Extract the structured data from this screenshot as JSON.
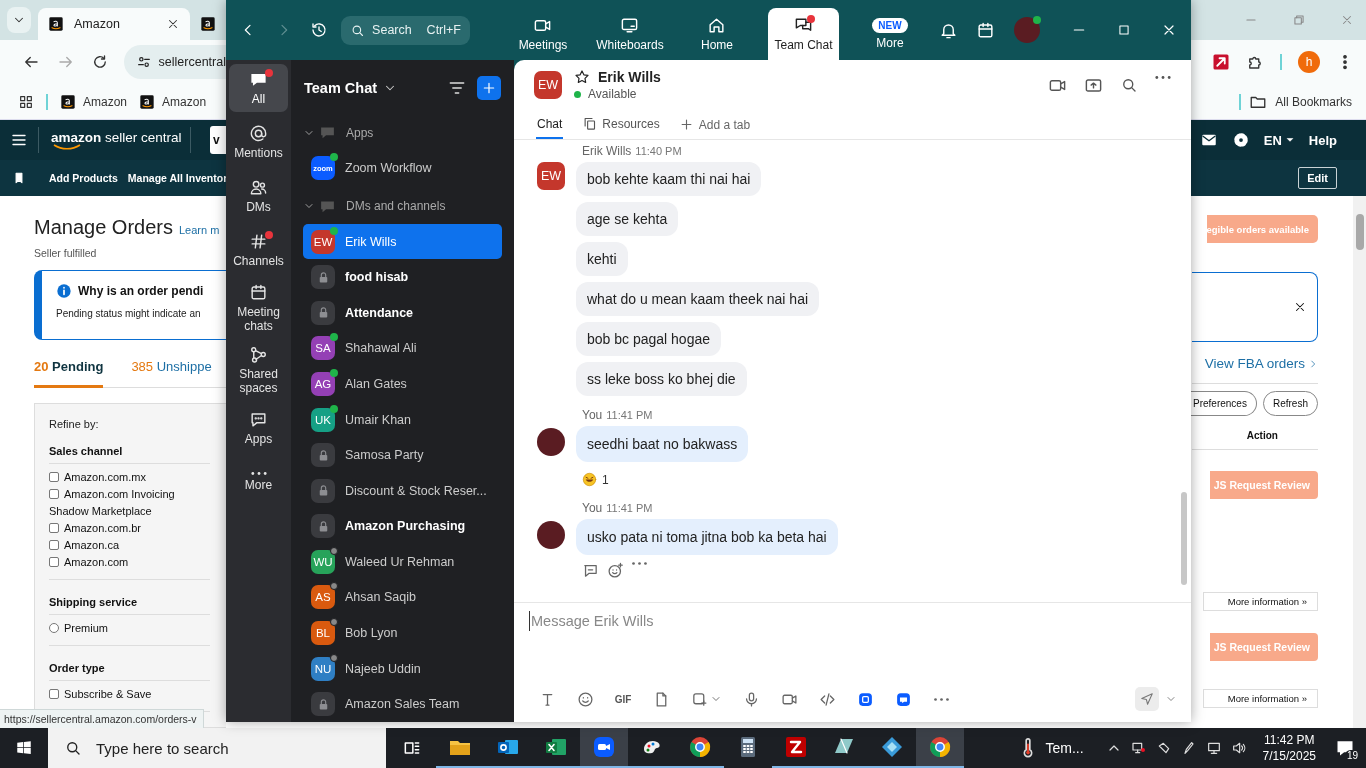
{
  "browser": {
    "tabs": [
      {
        "title": "Amazon",
        "selected": true
      },
      {
        "selected": false
      }
    ],
    "address": "sellercentral",
    "bookmarks": [
      "Amazon",
      "Amazon"
    ],
    "all_bookmarks": "All Bookmarks",
    "profile_initial": "h",
    "status_url": "https://sellercentral.amazon.com/orders-v"
  },
  "seller_central": {
    "logo_text": "**amazon** seller central",
    "search_box": "v",
    "nav_links": [
      "Add Products",
      "Manage All Inventor"
    ],
    "language": "EN",
    "help": "Help",
    "edit": "Edit",
    "title": "Manage Orders",
    "learn_more": "Learn m",
    "subtitle": "Seller fulfilled",
    "eligible_banner": "egible orders available",
    "notice": {
      "title": "Why is an order pendi",
      "text": "Pending status might indicate an"
    },
    "order_tabs": [
      {
        "count": "20",
        "label": "Pending",
        "selected": true
      },
      {
        "count": "385",
        "label": "Unshippe",
        "selected": false
      }
    ],
    "fba_link": "View FBA orders",
    "buttons": [
      "Preferences",
      "Refresh"
    ],
    "column_header": "Action",
    "rows": [
      {
        "action": "JS Request Review",
        "more": "More information »"
      },
      {
        "action": "JS Request Review",
        "more": "More information »"
      }
    ],
    "filters": {
      "title": "Refine by:",
      "groups": [
        {
          "title": "Sales channel",
          "options": [
            {
              "kind": "checkbox",
              "label": "Amazon.com.mx",
              "checked": false
            },
            {
              "kind": "checkbox",
              "label": "Amazon.com Invoicing Shadow Marketplace",
              "checked": false
            },
            {
              "kind": "checkbox",
              "label": "Amazon.com.br",
              "checked": false
            },
            {
              "kind": "checkbox",
              "label": "Amazon.ca",
              "checked": false
            },
            {
              "kind": "checkbox",
              "label": "Amazon.com",
              "checked": false
            }
          ]
        },
        {
          "title": "Shipping service",
          "options": [
            {
              "kind": "radio",
              "label": "Premium",
              "checked": false
            }
          ]
        },
        {
          "title": "Order type",
          "options": [
            {
              "kind": "checkbox",
              "label": "Subscribe & Save",
              "checked": false
            }
          ]
        }
      ]
    }
  },
  "zoom": {
    "search": {
      "placeholder": "Search",
      "shortcut": "Ctrl+F"
    },
    "nav": [
      {
        "kind": "meetings",
        "label": "Meetings",
        "selected": false,
        "dot": false
      },
      {
        "kind": "whiteboards",
        "label": "Whiteboards",
        "selected": false,
        "dot": false
      },
      {
        "kind": "home",
        "label": "Home",
        "selected": false,
        "dot": false
      },
      {
        "kind": "chat",
        "label": "Team Chat",
        "selected": true,
        "dot": true
      },
      {
        "kind": "more",
        "label": "More",
        "selected": false,
        "dot": false,
        "badge": "NEW"
      }
    ],
    "rail": [
      {
        "kind": "all",
        "label": "All",
        "selected": true,
        "dot": true
      },
      {
        "kind": "mentions",
        "label": "Mentions",
        "selected": false,
        "dot": false
      },
      {
        "kind": "dms",
        "label": "DMs",
        "selected": false,
        "dot": false
      },
      {
        "kind": "channels",
        "label": "Channels",
        "selected": false,
        "dot": true
      },
      {
        "kind": "meetings",
        "label": "Meeting chats",
        "selected": false,
        "dot": false
      },
      {
        "kind": "spaces",
        "label": "Shared spaces",
        "selected": false,
        "dot": false
      },
      {
        "kind": "apps",
        "label": "Apps",
        "selected": false,
        "dot": false
      },
      {
        "kind": "more",
        "label": "More",
        "selected": false,
        "dot": false
      }
    ],
    "list": {
      "title": "Team Chat",
      "sections": [
        {
          "title": "Apps",
          "expanded": true,
          "items": [
            {
              "kind": "app",
              "logo_text": "zoom",
              "name": "Zoom Workflow",
              "available": true,
              "unread": false,
              "selected": false
            }
          ]
        },
        {
          "title": "DMs and channels",
          "expanded": true,
          "items": [
            {
              "kind": "dm",
              "initials": "EW",
              "color": "#c4372c",
              "name": "Erik Wills",
              "available": true,
              "unread": false,
              "selected": true
            },
            {
              "kind": "channel",
              "name": "food hisab",
              "unread": true,
              "selected": false
            },
            {
              "kind": "channel",
              "name": "Attendance",
              "unread": true,
              "selected": false
            },
            {
              "kind": "dm",
              "initials": "SA",
              "color": "#9440b5",
              "name": "Shahawal Ali",
              "available": true,
              "unread": false,
              "selected": false
            },
            {
              "kind": "dm",
              "initials": "AG",
              "color": "#9440b5",
              "name": "Alan Gates",
              "available": true,
              "unread": false,
              "selected": false
            },
            {
              "kind": "dm",
              "initials": "UK",
              "color": "#16a085",
              "name": "Umair Khan",
              "available": true,
              "unread": false,
              "selected": false
            },
            {
              "kind": "channel",
              "name": "Samosa Party",
              "unread": false,
              "selected": false
            },
            {
              "kind": "channel",
              "name": "Discount & Stock Reser...",
              "unread": false,
              "selected": false
            },
            {
              "kind": "channel",
              "name": "Amazon Purchasing",
              "unread": true,
              "selected": false
            },
            {
              "kind": "dm",
              "initials": "WU",
              "color": "#27a35a",
              "name": "Waleed Ur Rehman",
              "available": false,
              "unread": false,
              "selected": false
            },
            {
              "kind": "dm",
              "initials": "AS",
              "color": "#d95a0f",
              "name": "Ahsan Saqib",
              "available": false,
              "unread": false,
              "selected": false
            },
            {
              "kind": "dm",
              "initials": "BL",
              "color": "#d95a0f",
              "name": "Bob Lyon",
              "available": false,
              "unread": false,
              "selected": false
            },
            {
              "kind": "dm",
              "initials": "NU",
              "color": "#2f7fc4",
              "name": "Najeeb Uddin",
              "available": false,
              "unread": false,
              "selected": false
            },
            {
              "kind": "channel",
              "name": "Amazon Sales Team",
              "unread": false,
              "selected": false
            }
          ]
        }
      ]
    },
    "chat": {
      "contact": {
        "initials": "EW",
        "color": "#c4372c",
        "name": "Erik Wills",
        "starred": false,
        "available": true,
        "status": "Available"
      },
      "tabs": [
        {
          "kind": "chat",
          "label": "Chat",
          "selected": true
        },
        {
          "kind": "resources",
          "label": "Resources",
          "selected": false
        }
      ],
      "add_tab": "Add a tab",
      "messages": [
        {
          "sender": "Erik Wills",
          "time": "11:40 PM",
          "mine": false,
          "initials": "EW",
          "color": "#c4372c",
          "bubbles": [
            "bob kehte kaam thi nai hai",
            "age se kehta",
            "kehti",
            "what do u mean kaam theek nai hai",
            "bob bc pagal hogae",
            "ss leke boss ko bhej die"
          ]
        },
        {
          "sender": "You",
          "time": "11:41 PM",
          "mine": true,
          "bubbles": [
            "seedhi baat no bakwass"
          ],
          "reactions": [
            {
              "count": "1"
            }
          ]
        },
        {
          "sender": "You",
          "time": "11:41 PM",
          "mine": true,
          "bubbles": [
            "usko pata ni toma jitna bob ka beta hai"
          ],
          "actions": true
        }
      ],
      "composer": {
        "placeholder": "Message Erik Wills",
        "gif": "GIF"
      }
    }
  },
  "taskbar": {
    "search_placeholder": "Type here to search",
    "apps": [
      {
        "kind": "explorer",
        "running": true,
        "selected": false
      },
      {
        "kind": "outlook",
        "running": true,
        "selected": false
      },
      {
        "kind": "excel",
        "running": true,
        "selected": false
      },
      {
        "kind": "zoom",
        "running": true,
        "selected": true
      },
      {
        "kind": "paint",
        "running": true,
        "selected": false
      },
      {
        "kind": "chrome",
        "running": true,
        "selected": false
      },
      {
        "kind": "calculator",
        "running": false,
        "selected": false
      },
      {
        "kind": "filezilla",
        "running": true,
        "selected": false
      },
      {
        "kind": "glass",
        "running": true,
        "selected": false
      },
      {
        "kind": "diamond",
        "running": true,
        "selected": false
      },
      {
        "kind": "chrome",
        "running": true,
        "selected": true
      }
    ],
    "weather": "Tem...",
    "time": "11:42 PM",
    "date": "7/15/2025",
    "notifications": "19"
  }
}
